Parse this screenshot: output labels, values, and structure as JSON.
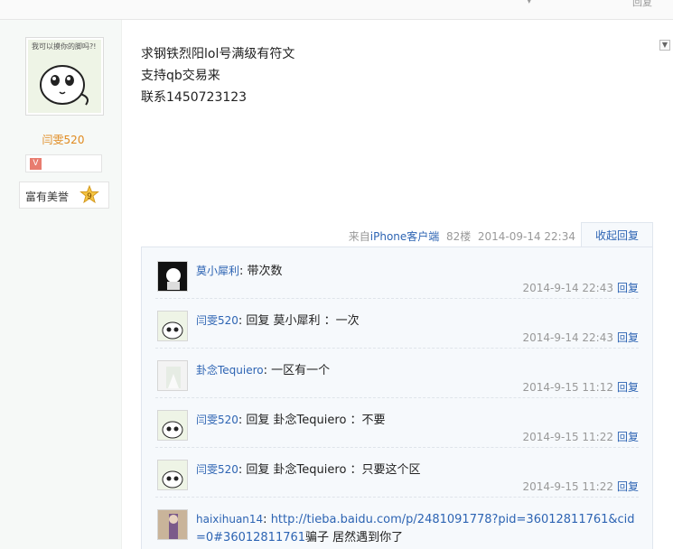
{
  "post": {
    "author": {
      "name": "闫雯520",
      "avatar_caption": "我可以摸你的脚吗?!",
      "honor_title": "富有美誉",
      "honor_level": "9"
    },
    "lines": [
      "求钢铁烈阳lol号满级有符文",
      "支持qb交易来",
      "联系1450723123"
    ],
    "meta": {
      "source_prefix": "来自",
      "client": "iPhone客户端",
      "floor": "82楼",
      "time": "2014-09-14 22:34"
    },
    "collapse_label": "收起回复"
  },
  "replies": [
    {
      "user": "莫小犀利",
      "text": "带次数",
      "time": "2014-9-14 22:43",
      "reply_label": "回复"
    },
    {
      "user": "闫雯520",
      "text": "回复 莫小犀利 ：一次",
      "time": "2014-9-14 22:43",
      "reply_label": "回复"
    },
    {
      "user": "卦念Tequiero",
      "text": "一区有一个",
      "time": "2014-9-15 11:12",
      "reply_label": "回复"
    },
    {
      "user": "闫雯520",
      "text": "回复 卦念Tequiero ：不要",
      "time": "2014-9-15 11:22",
      "reply_label": "回复"
    },
    {
      "user": "闫雯520",
      "text": "回复 卦念Tequiero ：只要这个区",
      "time": "2014-9-15 11:22",
      "reply_label": "回复"
    },
    {
      "user": "haixihuan14",
      "link": "http://tieba.baidu.com/p/2481091778?pid=36012811761&cid=0#36012811761",
      "text": "骗子 居然遇到你了"
    }
  ],
  "top_right_label": "回复",
  "colors": {
    "link": "#2d64b3",
    "username": "#e08a1f",
    "meta": "#999999"
  },
  "icons": [
    "dropdown-arrow-icon",
    "honor-star-icon",
    "badge-icon"
  ]
}
